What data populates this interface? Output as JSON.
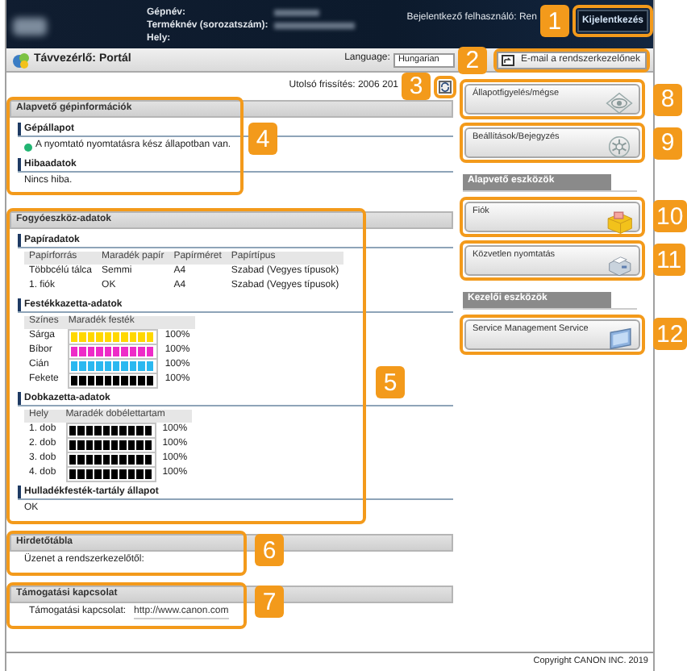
{
  "header": {
    "fields": [
      "Gépnév:",
      "Terméknév (sorozatszám):",
      "Hely:"
    ],
    "user": "Bejelentkező felhasználó: Ren",
    "logout_button": "Kijelentkezés",
    "logout_callout": "1"
  },
  "toolbar": {
    "title": "Távvezérlő: Portál",
    "language_label": "Language:",
    "language": "Hungarian",
    "email_button": "E-mail a rendszerkezelőnek",
    "email_callout": "2"
  },
  "last_update": "Utolsó frissítés: 2006 201",
  "refresh_callout": "3",
  "sections": [
    {
      "title": "Alapvető gépinformációk",
      "callout": "4",
      "blocks": [
        {
          "kind": "status",
          "heading": "Gépállapot",
          "text": "A nyomtató nyomtatásra kész állapotban van.",
          "color": "#22b573"
        },
        {
          "kind": "text",
          "heading": "Hibaadatok",
          "text": "Nincs hiba."
        }
      ]
    },
    {
      "title": "Fogyóeszköz-adatok",
      "callout": "5",
      "blocks": [
        {
          "kind": "table",
          "heading": "Papíradatok",
          "columns": [
            "Papírforrás",
            "Maradék papír",
            "Papírméret",
            "Papírtípus"
          ],
          "rows": [
            [
              "Többcélú tálca",
              "Semmi",
              "A4",
              "Szabad (Vegyes típusok)"
            ],
            [
              "1. fiók",
              "OK",
              "A4",
              "Szabad (Vegyes típusok)"
            ]
          ]
        },
        {
          "kind": "meters",
          "heading": "Festékkazetta-adatok",
          "columns": [
            "Színes",
            "Maradék festék"
          ],
          "rows": [
            {
              "name": "Sárga",
              "level": 1,
              "reading": "100%",
              "color": "#ffd800"
            },
            {
              "name": "Bíbor",
              "level": 1,
              "reading": "100%",
              "color": "#ee2bc8"
            },
            {
              "name": "Cián",
              "level": 1,
              "reading": "100%",
              "color": "#2ab8f0"
            },
            {
              "name": "Fekete",
              "level": 1,
              "reading": "100%",
              "color": "#000000"
            }
          ]
        },
        {
          "kind": "meters",
          "heading": "Dobkazetta-adatok",
          "columns": [
            "Hely",
            "Maradék dobélettartam"
          ],
          "rows": [
            {
              "name": "1. dob",
              "level": 1,
              "reading": "100%",
              "color": "#000000"
            },
            {
              "name": "2. dob",
              "level": 1,
              "reading": "100%",
              "color": "#000000"
            },
            {
              "name": "3. dob",
              "level": 1,
              "reading": "100%",
              "color": "#000000"
            },
            {
              "name": "4. dob",
              "level": 1,
              "reading": "100%",
              "color": "#000000"
            }
          ]
        },
        {
          "kind": "text",
          "heading": "Hulladékfesték-tartály állapot",
          "text": "OK"
        }
      ]
    },
    {
      "title": "Hirdetőtábla",
      "callout": "6",
      "blocks": [
        {
          "kind": "text",
          "text": "Üzenet a rendszerkezelőtől:"
        }
      ]
    },
    {
      "title": "Támogatási kapcsolat",
      "callout": "7",
      "blocks": [
        {
          "kind": "link",
          "label": "Támogatási kapcsolat:",
          "url": "http://www.canon.com"
        }
      ]
    }
  ],
  "tools": [
    {
      "kind": "tile",
      "label": "Állapotfigyelés/mégse",
      "callout": "8"
    },
    {
      "kind": "tile",
      "label": "Beállítások/Bejegyzés",
      "callout": "9"
    },
    {
      "kind": "heading",
      "label": "Alapvető eszközök"
    },
    {
      "kind": "tile",
      "label": "Fiók",
      "callout": "10"
    },
    {
      "kind": "tile",
      "label": "Közvetlen nyomtatás",
      "callout": "11"
    },
    {
      "kind": "heading",
      "label": "Kezelői eszközök"
    },
    {
      "kind": "tile",
      "label": "Service Management Service",
      "callout": "12"
    }
  ],
  "footer": "Copyright CANON INC. 2019"
}
